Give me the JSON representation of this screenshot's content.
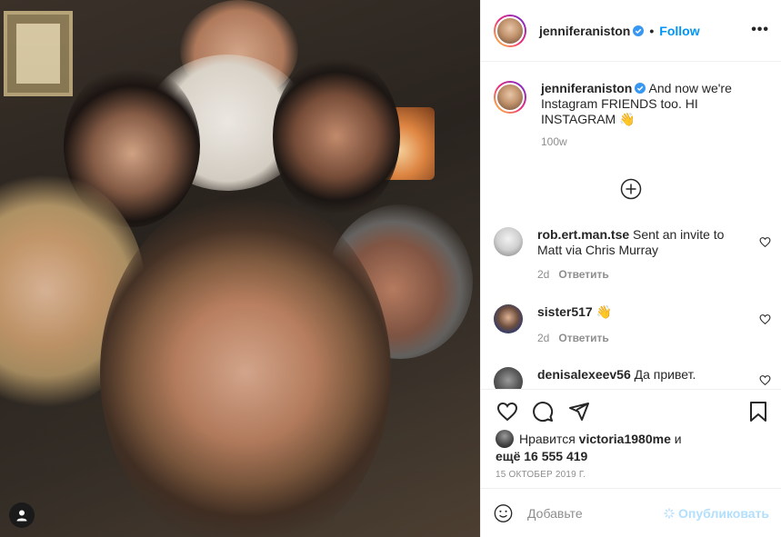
{
  "post": {
    "author": "jenniferaniston",
    "follow_label": "Follow",
    "more_label": "•••",
    "caption": "And now we're Instagram FRIENDS too. HI INSTAGRAM 👋",
    "caption_time": "100w"
  },
  "comments": [
    {
      "user": "rob.ert.man.tse",
      "text": "Sent an invite to Matt via Chris Murray",
      "time": "2d",
      "reply_label": "Ответить"
    },
    {
      "user": "sister517",
      "text": "👋",
      "time": "2d",
      "reply_label": "Ответить"
    },
    {
      "user": "denisalexeev56",
      "text": "Да привет.",
      "time": "",
      "reply_label": ""
    }
  ],
  "likes": {
    "prefix": "Нравится",
    "user": "victoria1980me",
    "middle": "и",
    "more": "ещё 16 555 419"
  },
  "date": "15 ОКТОБЕР 2019 Г.",
  "add_comment": {
    "placeholder": "Добавьте",
    "publish_label": "Опубликовать"
  },
  "icons": {
    "verified": "verified-badge-icon",
    "like": "heart-icon",
    "comment": "comment-icon",
    "share": "paper-plane-icon",
    "save": "bookmark-icon",
    "emoji": "smiley-icon",
    "user_tag": "user-tag-icon",
    "load_more": "plus-circle-icon"
  },
  "colors": {
    "accent": "#0095f6",
    "muted": "#8e8e8e",
    "publish_disabled": "#b2dffc"
  }
}
